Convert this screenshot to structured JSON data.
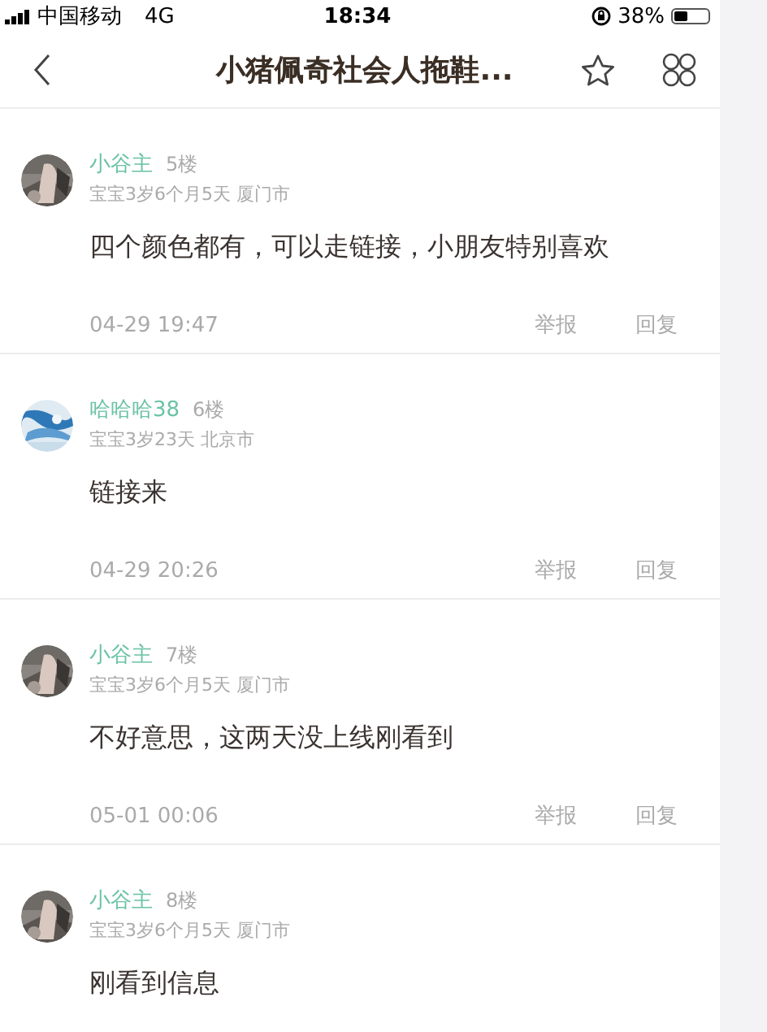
{
  "status_bar": {
    "carrier": "中国移动",
    "network": "4G",
    "time": "18:34",
    "battery": "38%"
  },
  "nav": {
    "title": "小猪佩奇社会人拖鞋..."
  },
  "posts": [
    {
      "author": "小谷主",
      "floor": "5楼",
      "meta": "宝宝3岁6个月5天  厦门市",
      "body": "四个颜色都有，可以走链接，小朋友特别喜欢",
      "time": "04-29 19:47",
      "actions": [
        "举报",
        "回复"
      ]
    },
    {
      "author": "哈哈哈38",
      "floor": "6楼",
      "meta": "宝宝3岁23天  北京市",
      "body": "链接来",
      "time": "04-29 20:26",
      "actions": [
        "举报",
        "回复"
      ]
    },
    {
      "author": "小谷主",
      "floor": "7楼",
      "meta": "宝宝3岁6个月5天  厦门市",
      "body": "不好意思，这两天没上线刚看到",
      "time": "05-01 00:06",
      "actions": [
        "举报",
        "回复"
      ]
    },
    {
      "author": "小谷主",
      "floor": "8楼",
      "meta": "宝宝3岁6个月5天  厦门市",
      "body": "刚看到信息"
    }
  ]
}
